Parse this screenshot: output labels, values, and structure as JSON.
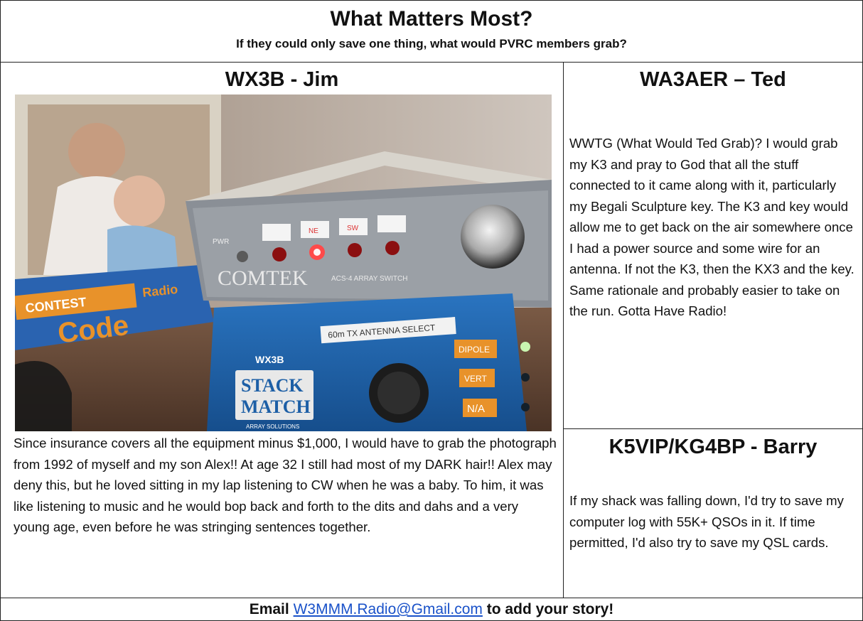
{
  "header": {
    "title": "What Matters Most?",
    "subtitle": "If they could only save one thing, what would PVRC members grab?"
  },
  "left": {
    "heading": "WX3B - Jim",
    "photo": {
      "labels": {
        "comtek": "COMTEK",
        "comtek_model": "ACS-4 ARRAY SWITCH",
        "pwr": "PWR",
        "btn_ne": "NE",
        "btn_sw": "SW",
        "select_label": "60m TX ANTENNA SELECT",
        "stack_brand": "WX3B",
        "stack_line1": "STACK",
        "stack_line2": "MATCH",
        "stack_sub": "ARRAY SOLUTIONS",
        "dipole": "DIPOLE",
        "vert": "VERT",
        "na": "N/A",
        "box_contest": "CONTEST",
        "box_code": "Code",
        "box_radio": "Radio"
      }
    },
    "story": "Since insurance covers all the equipment minus $1,000, I would have to grab the photograph from 1992 of myself and my son Alex!!  At age 32 I still had most of my DARK hair!!  Alex may deny this, but he loved sitting in my lap listening to CW when he was a baby.  To him, it was like listening to music and he would bop back and forth to the dits and dahs and a very young age, even before he was stringing sentences together."
  },
  "ted": {
    "heading": "WA3AER – Ted",
    "story": "WWTG (What Would Ted Grab)? I would grab my K3 and pray to God that all the stuff connected to it came along with it, particularly my Begali Sculpture key.  The K3 and key would allow me to get back on the air somewhere once I had a power source and some wire for an antenna.  If not the K3, then the KX3 and the key. Same rationale and probably easier to take on the run. Gotta Have Radio!"
  },
  "barry": {
    "heading": "K5VIP/KG4BP - Barry",
    "story": "If my shack was falling down, I'd try to save my computer log with 55K+ QSOs in it.  If time permitted, I'd also try to save my QSL cards."
  },
  "footer": {
    "prefix": "Email",
    "email": "W3MMM.Radio@Gmail.com",
    "suffix": "to add your story!"
  },
  "colors": {
    "link": "#1a52c9",
    "border": "#222222",
    "stackmatch_blue": "#1d5fa6",
    "comtek_panel": "#8a8f96"
  }
}
